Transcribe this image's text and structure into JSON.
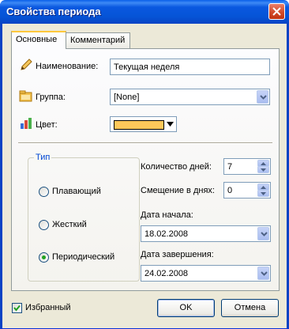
{
  "window": {
    "title": "Свойства периода"
  },
  "tabs": [
    {
      "label": "Основные",
      "active": true
    },
    {
      "label": "Комментарий",
      "active": false
    }
  ],
  "form": {
    "name": {
      "label": "Наименование:",
      "value": "Текущая неделя",
      "icon": "pencil-icon"
    },
    "group": {
      "label": "Группа:",
      "value": "[None]",
      "icon": "folder-icon"
    },
    "color": {
      "label": "Цвет:",
      "value": "#ffc85a",
      "icon": "chart-icon"
    }
  },
  "type_group": {
    "legend": "Тип",
    "options": [
      {
        "label": "Плавающий",
        "selected": false
      },
      {
        "label": "Жесткий",
        "selected": false
      },
      {
        "label": "Периодический",
        "selected": true
      }
    ]
  },
  "days_count": {
    "label": "Количество дней:",
    "value": "7"
  },
  "offset_days": {
    "label": "Смещение в днях:",
    "value": "0"
  },
  "start_date": {
    "label": "Дата начала:",
    "value": "18.02.2008"
  },
  "end_date": {
    "label": "Дата завершения:",
    "value": "24.02.2008"
  },
  "footer": {
    "favorite": {
      "label": "Избранный",
      "checked": true
    },
    "ok_label": "OK",
    "cancel_label": "Отмена"
  },
  "colors": {
    "titlebar": "#0554d6",
    "selected_tab_accent": "#ffc83c",
    "group_legend": "#0046d5"
  }
}
